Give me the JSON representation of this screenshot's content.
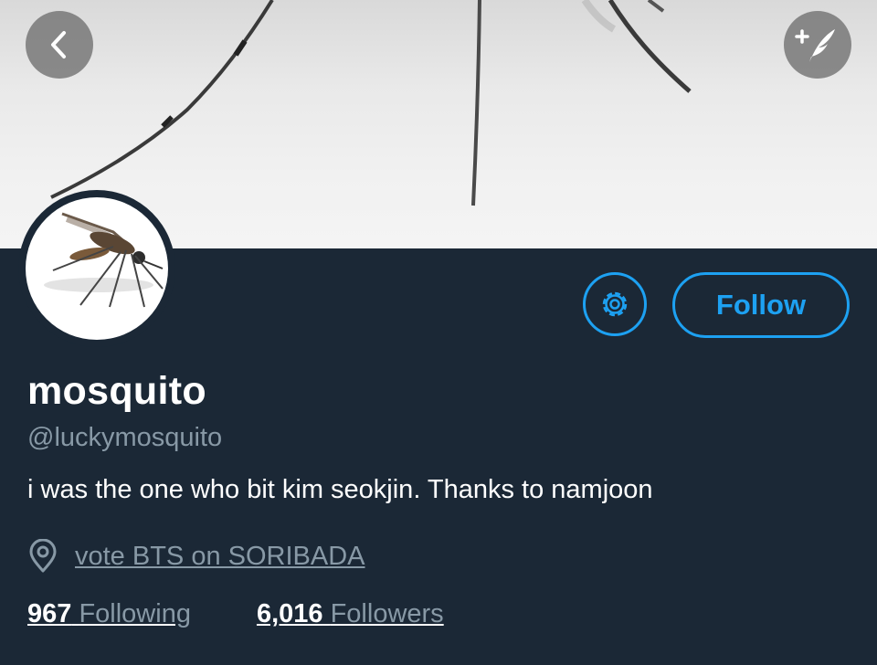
{
  "profile": {
    "display_name": "mosquito",
    "handle": "@luckymosquito",
    "bio": "i was the one who bit kim seokjin. Thanks to namjoon",
    "location": "vote BTS on SORIBADA",
    "following_count": "967",
    "following_label": "Following",
    "followers_count": "6,016",
    "followers_label": "Followers"
  },
  "actions": {
    "follow_label": "Follow"
  },
  "icons": {
    "back": "chevron-left-icon",
    "compose": "compose-quill-icon",
    "settings": "gear-icon",
    "location": "location-pin-icon"
  },
  "colors": {
    "accent": "#1da1f2",
    "background": "#1b2836",
    "secondary_text": "#8899a6"
  }
}
